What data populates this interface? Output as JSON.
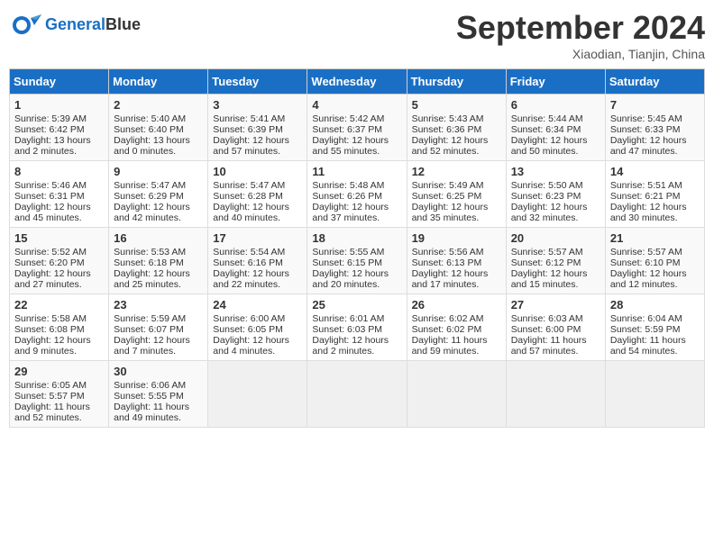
{
  "header": {
    "logo_line1": "General",
    "logo_line2": "Blue",
    "month": "September 2024",
    "location": "Xiaodian, Tianjin, China"
  },
  "weekdays": [
    "Sunday",
    "Monday",
    "Tuesday",
    "Wednesday",
    "Thursday",
    "Friday",
    "Saturday"
  ],
  "weeks": [
    [
      {
        "day": "1",
        "info": "Sunrise: 5:39 AM\nSunset: 6:42 PM\nDaylight: 13 hours\nand 2 minutes."
      },
      {
        "day": "2",
        "info": "Sunrise: 5:40 AM\nSunset: 6:40 PM\nDaylight: 13 hours\nand 0 minutes."
      },
      {
        "day": "3",
        "info": "Sunrise: 5:41 AM\nSunset: 6:39 PM\nDaylight: 12 hours\nand 57 minutes."
      },
      {
        "day": "4",
        "info": "Sunrise: 5:42 AM\nSunset: 6:37 PM\nDaylight: 12 hours\nand 55 minutes."
      },
      {
        "day": "5",
        "info": "Sunrise: 5:43 AM\nSunset: 6:36 PM\nDaylight: 12 hours\nand 52 minutes."
      },
      {
        "day": "6",
        "info": "Sunrise: 5:44 AM\nSunset: 6:34 PM\nDaylight: 12 hours\nand 50 minutes."
      },
      {
        "day": "7",
        "info": "Sunrise: 5:45 AM\nSunset: 6:33 PM\nDaylight: 12 hours\nand 47 minutes."
      }
    ],
    [
      {
        "day": "8",
        "info": "Sunrise: 5:46 AM\nSunset: 6:31 PM\nDaylight: 12 hours\nand 45 minutes."
      },
      {
        "day": "9",
        "info": "Sunrise: 5:47 AM\nSunset: 6:29 PM\nDaylight: 12 hours\nand 42 minutes."
      },
      {
        "day": "10",
        "info": "Sunrise: 5:47 AM\nSunset: 6:28 PM\nDaylight: 12 hours\nand 40 minutes."
      },
      {
        "day": "11",
        "info": "Sunrise: 5:48 AM\nSunset: 6:26 PM\nDaylight: 12 hours\nand 37 minutes."
      },
      {
        "day": "12",
        "info": "Sunrise: 5:49 AM\nSunset: 6:25 PM\nDaylight: 12 hours\nand 35 minutes."
      },
      {
        "day": "13",
        "info": "Sunrise: 5:50 AM\nSunset: 6:23 PM\nDaylight: 12 hours\nand 32 minutes."
      },
      {
        "day": "14",
        "info": "Sunrise: 5:51 AM\nSunset: 6:21 PM\nDaylight: 12 hours\nand 30 minutes."
      }
    ],
    [
      {
        "day": "15",
        "info": "Sunrise: 5:52 AM\nSunset: 6:20 PM\nDaylight: 12 hours\nand 27 minutes."
      },
      {
        "day": "16",
        "info": "Sunrise: 5:53 AM\nSunset: 6:18 PM\nDaylight: 12 hours\nand 25 minutes."
      },
      {
        "day": "17",
        "info": "Sunrise: 5:54 AM\nSunset: 6:16 PM\nDaylight: 12 hours\nand 22 minutes."
      },
      {
        "day": "18",
        "info": "Sunrise: 5:55 AM\nSunset: 6:15 PM\nDaylight: 12 hours\nand 20 minutes."
      },
      {
        "day": "19",
        "info": "Sunrise: 5:56 AM\nSunset: 6:13 PM\nDaylight: 12 hours\nand 17 minutes."
      },
      {
        "day": "20",
        "info": "Sunrise: 5:57 AM\nSunset: 6:12 PM\nDaylight: 12 hours\nand 15 minutes."
      },
      {
        "day": "21",
        "info": "Sunrise: 5:57 AM\nSunset: 6:10 PM\nDaylight: 12 hours\nand 12 minutes."
      }
    ],
    [
      {
        "day": "22",
        "info": "Sunrise: 5:58 AM\nSunset: 6:08 PM\nDaylight: 12 hours\nand 9 minutes."
      },
      {
        "day": "23",
        "info": "Sunrise: 5:59 AM\nSunset: 6:07 PM\nDaylight: 12 hours\nand 7 minutes."
      },
      {
        "day": "24",
        "info": "Sunrise: 6:00 AM\nSunset: 6:05 PM\nDaylight: 12 hours\nand 4 minutes."
      },
      {
        "day": "25",
        "info": "Sunrise: 6:01 AM\nSunset: 6:03 PM\nDaylight: 12 hours\nand 2 minutes."
      },
      {
        "day": "26",
        "info": "Sunrise: 6:02 AM\nSunset: 6:02 PM\nDaylight: 11 hours\nand 59 minutes."
      },
      {
        "day": "27",
        "info": "Sunrise: 6:03 AM\nSunset: 6:00 PM\nDaylight: 11 hours\nand 57 minutes."
      },
      {
        "day": "28",
        "info": "Sunrise: 6:04 AM\nSunset: 5:59 PM\nDaylight: 11 hours\nand 54 minutes."
      }
    ],
    [
      {
        "day": "29",
        "info": "Sunrise: 6:05 AM\nSunset: 5:57 PM\nDaylight: 11 hours\nand 52 minutes."
      },
      {
        "day": "30",
        "info": "Sunrise: 6:06 AM\nSunset: 5:55 PM\nDaylight: 11 hours\nand 49 minutes."
      },
      {
        "day": "",
        "info": ""
      },
      {
        "day": "",
        "info": ""
      },
      {
        "day": "",
        "info": ""
      },
      {
        "day": "",
        "info": ""
      },
      {
        "day": "",
        "info": ""
      }
    ]
  ]
}
